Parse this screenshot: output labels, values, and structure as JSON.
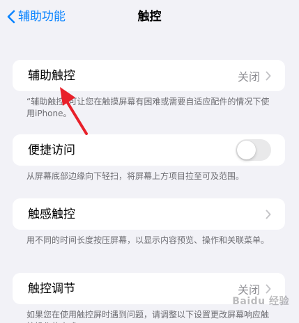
{
  "nav": {
    "back_label": "辅助功能",
    "title": "触控"
  },
  "rows": {
    "assistive_touch": {
      "label": "辅助触控",
      "value": "关闭"
    },
    "reachability": {
      "label": "便捷访问",
      "toggle_on": false
    },
    "haptic_touch": {
      "label": "触感触控"
    },
    "touch_accommodations": {
      "label": "触控调节",
      "value": "关闭"
    }
  },
  "footnotes": {
    "assistive_touch": "“辅助触控”可让您在触摸屏幕有困难或需要自适应配件的情况下使用iPhone。",
    "reachability": "从屏幕底部边缘向下轻扫，将屏幕上方项目拉至可及范围。",
    "haptic_touch": "用不同的时间长度按压屏幕，以显示内容预览、操作和关联菜单。",
    "touch_accommodations": "如果您在使用触控屏时遇到问题，请调整以下设置更改屏幕响应触控操作的方式。"
  },
  "colors": {
    "accent": "#0a84ff",
    "background": "#f2f2f7",
    "annotation_arrow": "#e8202a"
  },
  "icons": {
    "back": "chevron-left-icon",
    "disclosure": "chevron-right-icon"
  },
  "watermark": "Baidu 经验"
}
